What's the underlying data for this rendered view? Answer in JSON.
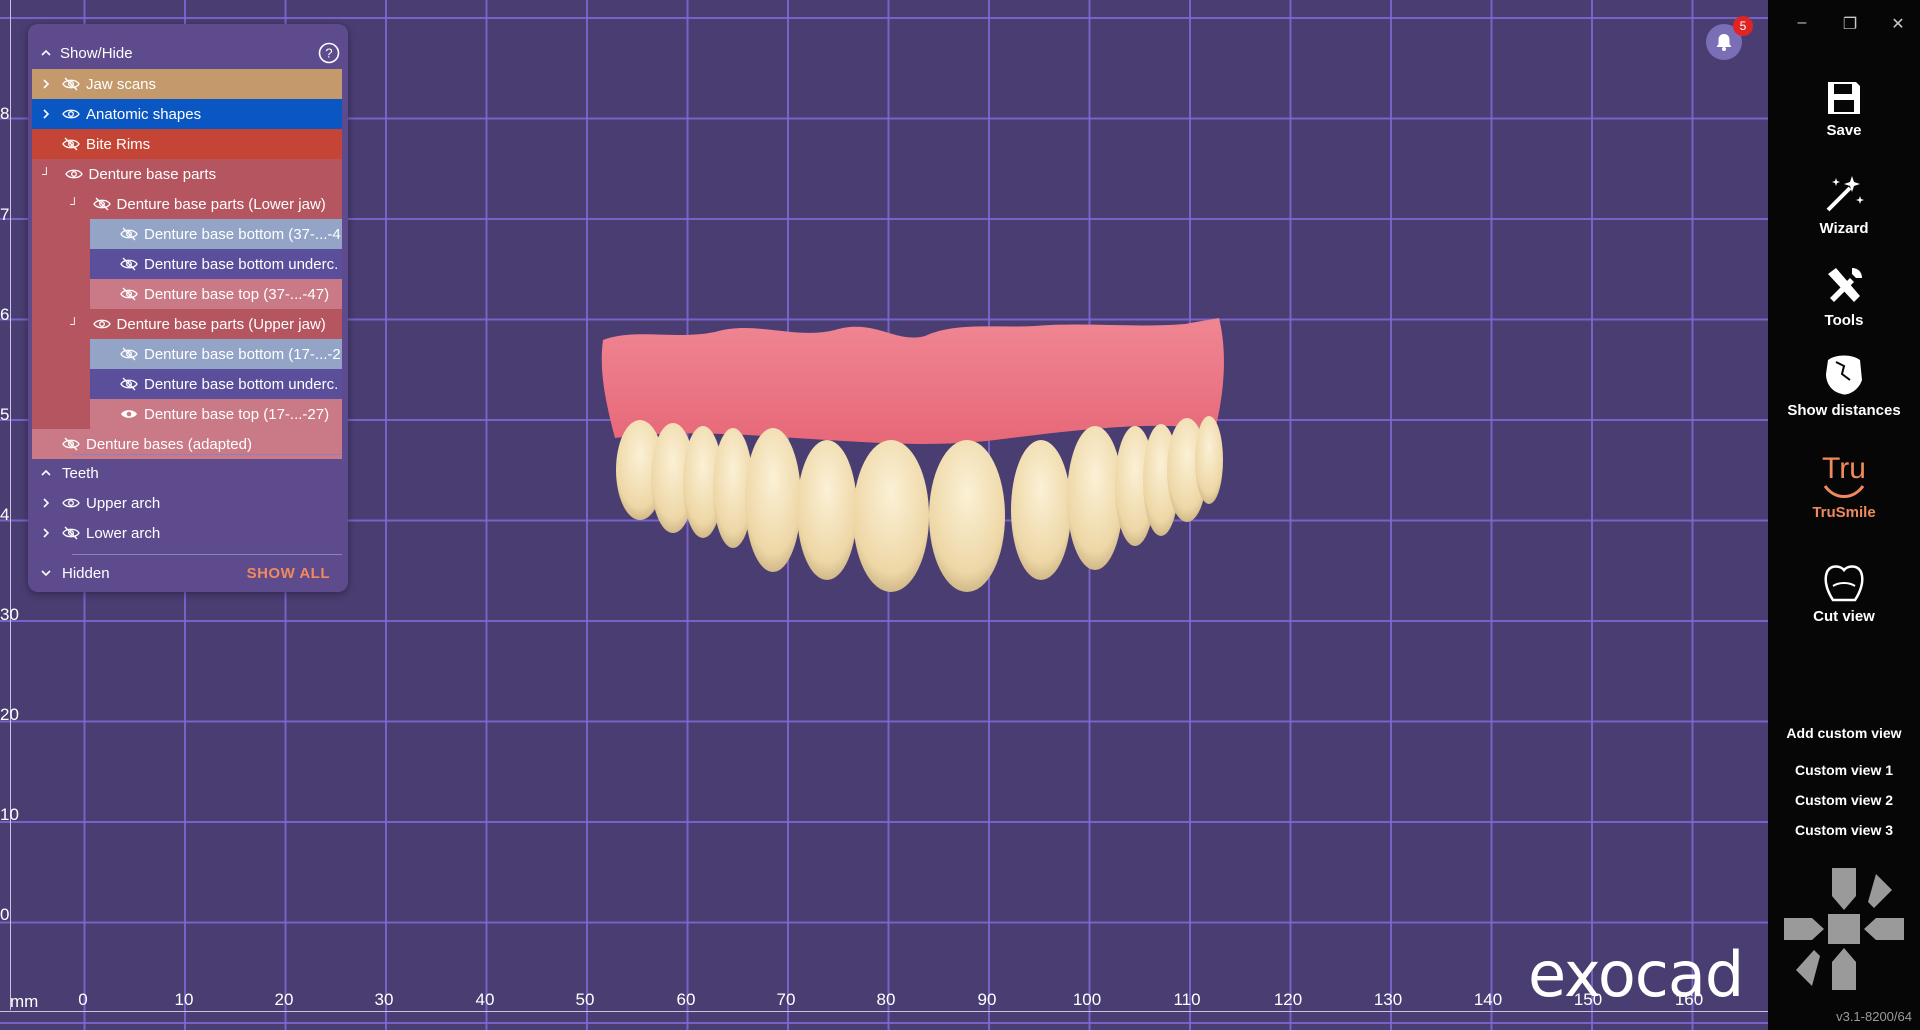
{
  "panel": {
    "title": "Show/Hide",
    "help": "?",
    "rows": [
      {
        "label": "Jaw scans"
      },
      {
        "label": "Anatomic shapes"
      },
      {
        "label": "Bite Rims"
      },
      {
        "label": "Denture base parts"
      },
      {
        "label": "Denture base parts (Lower jaw)"
      },
      {
        "label": "Denture base bottom (37-...-4"
      },
      {
        "label": "Denture base bottom underc."
      },
      {
        "label": "Denture base top (37-...-47)"
      },
      {
        "label": "Denture base parts (Upper jaw)"
      },
      {
        "label": "Denture base bottom (17-...-2"
      },
      {
        "label": "Denture base bottom underc."
      },
      {
        "label": "Denture base top (17-...-27)"
      },
      {
        "label": "Denture bases (adapted)"
      }
    ],
    "teeth": {
      "title": "Teeth",
      "upper": "Upper arch",
      "lower": "Lower arch"
    },
    "hidden": {
      "title": "Hidden",
      "show_all": "SHOW ALL"
    },
    "colors": {
      "jaw": "#c49a6c",
      "anatomic": "#0a56c2",
      "bite": "#c44536",
      "denture": "#b55560",
      "light": "#93a4c6",
      "dark": "#5b4f9b",
      "pink": "#c97a86"
    }
  },
  "ruler": {
    "unit": "mm",
    "x_ticks": [
      "0",
      "10",
      "20",
      "30",
      "40",
      "50",
      "60",
      "70",
      "80",
      "90",
      "100",
      "110",
      "120",
      "130",
      "140",
      "150",
      "160"
    ],
    "y_ticks": [
      "8",
      "7",
      "6",
      "5",
      "4",
      "30",
      "20",
      "10",
      "0"
    ]
  },
  "notifications": {
    "count": "5"
  },
  "sidebar": {
    "save": "Save",
    "wizard": "Wizard",
    "tools": "Tools",
    "show_distances": "Show distances",
    "trusmile_logo": "Tru",
    "trusmile": "TruSmile",
    "cut_view": "Cut view",
    "add_custom_view": "Add custom view",
    "custom_views": [
      "Custom view 1",
      "Custom view 2",
      "Custom view 3"
    ],
    "version": "v3.1-8200/64",
    "accent": "#f08a5d"
  },
  "brand": {
    "logo": "exocad"
  }
}
